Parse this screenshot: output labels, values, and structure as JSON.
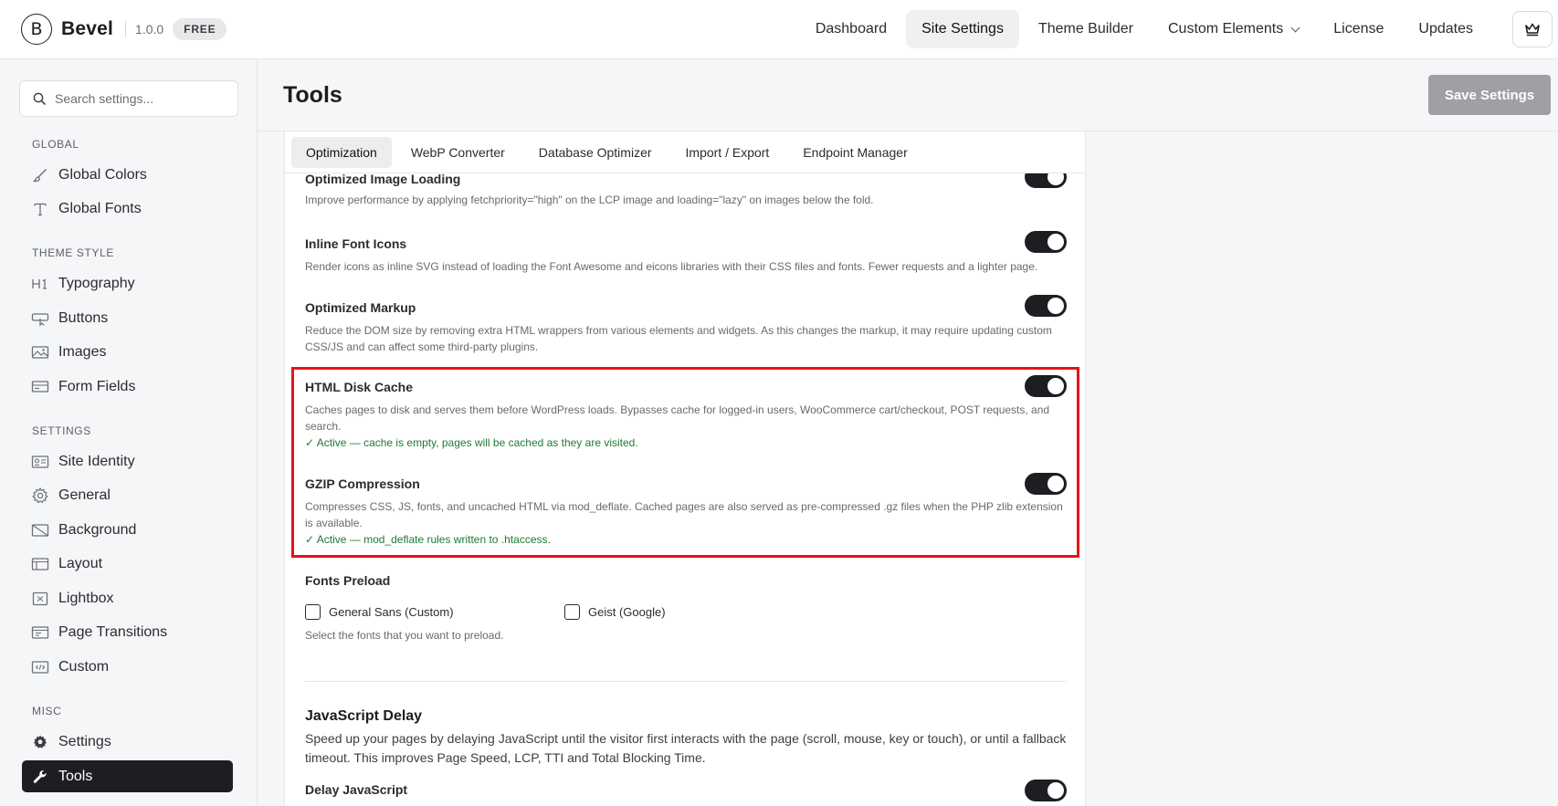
{
  "header": {
    "brand_letter": "B",
    "brand_name": "Bevel",
    "version": "1.0.0",
    "plan_badge": "FREE",
    "nav": [
      {
        "label": "Dashboard"
      },
      {
        "label": "Site Settings"
      },
      {
        "label": "Theme Builder"
      },
      {
        "label": "Custom Elements"
      },
      {
        "label": "License"
      },
      {
        "label": "Updates"
      }
    ]
  },
  "sidebar": {
    "search_placeholder": "Search settings...",
    "sections": {
      "global": "GLOBAL",
      "theme_style": "THEME STYLE",
      "settings": "SETTINGS",
      "misc": "MISC"
    },
    "items": {
      "global_colors": "Global Colors",
      "global_fonts": "Global Fonts",
      "typography": "Typography",
      "buttons": "Buttons",
      "images": "Images",
      "form_fields": "Form Fields",
      "site_identity": "Site Identity",
      "general": "General",
      "background": "Background",
      "layout": "Layout",
      "lightbox": "Lightbox",
      "page_transitions": "Page Transitions",
      "custom": "Custom",
      "settings": "Settings",
      "tools": "Tools"
    }
  },
  "main": {
    "title": "Tools",
    "save_label": "Save Settings",
    "tabs": [
      {
        "label": "Optimization"
      },
      {
        "label": "WebP Converter"
      },
      {
        "label": "Database Optimizer"
      },
      {
        "label": "Import / Export"
      },
      {
        "label": "Endpoint Manager"
      }
    ],
    "options": {
      "image_loading": {
        "title": "Optimized Image Loading",
        "desc": "Improve performance by applying fetchpriority=\"high\" on the LCP image and loading=\"lazy\" on images below the fold.",
        "enabled": true
      },
      "font_icons": {
        "title": "Inline Font Icons",
        "desc": "Render icons as inline SVG instead of loading the Font Awesome and eicons libraries with their CSS files and fonts. Fewer requests and a lighter page.",
        "enabled": true
      },
      "markup": {
        "title": "Optimized Markup",
        "desc": "Reduce the DOM size by removing extra HTML wrappers from various elements and widgets. As this changes the markup, it may require updating custom CSS/JS and can affect some third-party plugins.",
        "enabled": true
      },
      "disk_cache": {
        "title": "HTML Disk Cache",
        "desc": "Caches pages to disk and serves them before WordPress loads. Bypasses cache for logged-in users, WooCommerce cart/checkout, POST requests, and search.",
        "status": "✓ Active — cache is empty, pages will be cached as they are visited.",
        "enabled": true
      },
      "gzip": {
        "title": "GZIP Compression",
        "desc": "Compresses CSS, JS, fonts, and uncached HTML via mod_deflate. Cached pages are also served as pre-compressed .gz files when the PHP zlib extension is available.",
        "status": "✓ Active — mod_deflate rules written to .htaccess.",
        "enabled": true
      }
    },
    "fonts_preload": {
      "title": "Fonts Preload",
      "fonts": [
        {
          "label": "General Sans (Custom)",
          "checked": false
        },
        {
          "label": "Geist (Google)",
          "checked": false
        }
      ],
      "help": "Select the fonts that you want to preload."
    },
    "js_delay": {
      "title": "JavaScript Delay",
      "desc": "Speed up your pages by delaying JavaScript until the visitor first interacts with the page (scroll, mouse, key or touch), or until a fallback timeout. This improves Page Speed, LCP, TTI and Total Blocking Time.",
      "delay_label": "Delay JavaScript",
      "enabled": true
    }
  },
  "colors": {
    "highlight": "#e8111b",
    "active_status": "#1f7a36",
    "toggle_on": "#1d1e21"
  }
}
